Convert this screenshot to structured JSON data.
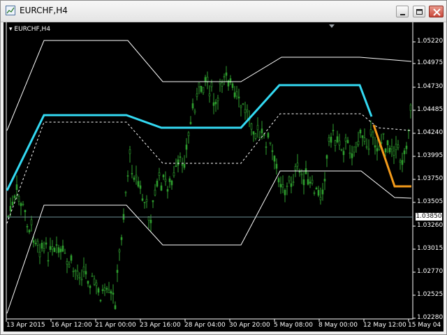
{
  "window": {
    "title": "EURCHF,H4"
  },
  "chart": {
    "symbol_label": "EURCHF,H4",
    "current_price": "1.03850",
    "colors": {
      "background": "#000000",
      "candles": "#2e9e2e",
      "midline_main": "#33d9f2",
      "midline_recent": "#f39a1a",
      "channel": "#ffffff",
      "price_line": "#6e8f96"
    },
    "y_axis_labels": [
      "1.05220",
      "1.04975",
      "1.04730",
      "1.04485",
      "1.04240",
      "1.03995",
      "1.03750",
      "1.03505",
      "1.03260",
      "1.03015",
      "1.02770",
      "1.02525",
      "1.02280"
    ],
    "x_axis_labels": [
      "13 Apr 2015",
      "16 Apr 12:00",
      "21 Apr 00:00",
      "23 Apr 16:00",
      "28 Apr 04:00",
      "30 Apr 20:00",
      "5 May 08:00",
      "8 May 00:00",
      "12 May 12:00",
      "15 May 04:00"
    ],
    "icons": {
      "app": "chart-app-icon",
      "minimize": "minimize-icon",
      "maximize": "maximize-icon",
      "close": "close-icon",
      "dropdown": "dropdown-triangle-icon"
    }
  }
}
